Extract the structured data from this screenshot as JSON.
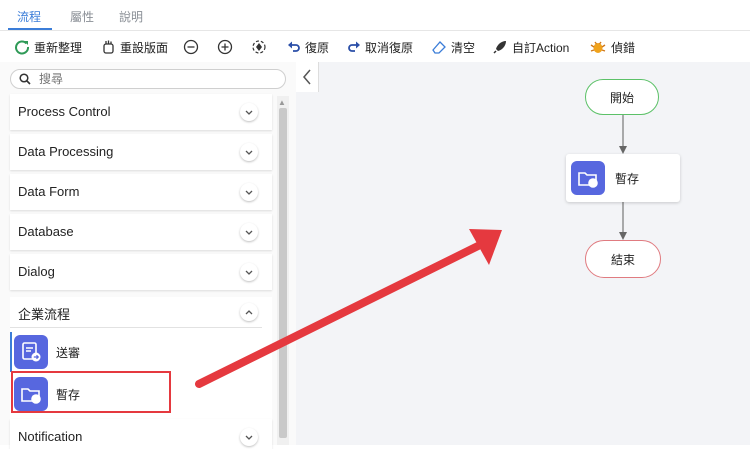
{
  "tabs": [
    {
      "label": "流程",
      "active": true
    },
    {
      "label": "屬性",
      "active": false
    },
    {
      "label": "說明",
      "active": false
    }
  ],
  "toolbar": {
    "rearrange": "重新整理",
    "reset_layout": "重設版面",
    "undo": "復原",
    "redo": "取消復原",
    "clear": "清空",
    "custom_action": "自訂Action",
    "debug": "偵錯"
  },
  "sidebar": {
    "search_placeholder": "搜尋",
    "groups": [
      {
        "label": "Process Control",
        "expanded": false
      },
      {
        "label": "Data Processing",
        "expanded": false
      },
      {
        "label": "Data Form",
        "expanded": false
      },
      {
        "label": "Database",
        "expanded": false
      },
      {
        "label": "Dialog",
        "expanded": false
      },
      {
        "label": "企業流程",
        "expanded": true
      },
      {
        "label": "Notification",
        "expanded": false
      }
    ],
    "items": [
      {
        "label": "送審",
        "icon": "send-review-icon"
      },
      {
        "label": "暫存",
        "icon": "temp-save-icon"
      }
    ]
  },
  "flow": {
    "start_label": "開始",
    "task_label": "暫存",
    "end_label": "結束"
  },
  "colors": {
    "accent": "#3b7dd8",
    "item_icon_bg": "#5767df",
    "start_border": "#5cc168",
    "end_border": "#e07b80",
    "annotation_red": "#e5393f"
  }
}
